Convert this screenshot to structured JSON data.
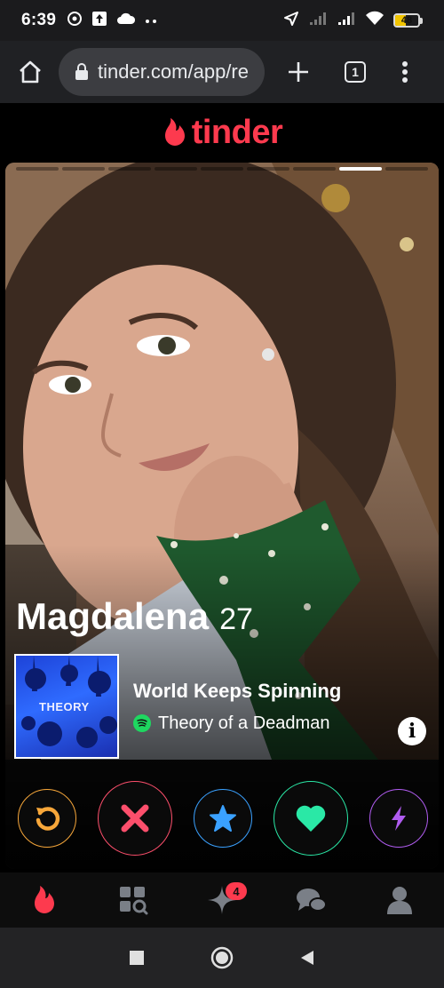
{
  "status_bar": {
    "time": "6:39",
    "battery_percent": "48",
    "battery_level": 0.48,
    "icons": [
      "whatsapp-icon",
      "upload-icon",
      "cloud-icon",
      "more-dots-icon",
      "location-arrow-icon",
      "signal-icon",
      "signal-icon",
      "wifi-icon",
      "battery-icon"
    ]
  },
  "browser": {
    "url": "tinder.com/app/re",
    "tab_count": "1",
    "icons": [
      "home-icon",
      "lock-icon",
      "plus-icon",
      "tabs-icon",
      "kebab-menu-icon"
    ]
  },
  "header": {
    "logo_text": "tinder",
    "brand_color": "#fd3a4e"
  },
  "profile": {
    "name": "Magdalena",
    "age": "27",
    "photo_count": 9,
    "active_photo": 8,
    "anthem": {
      "album_text": "THEORY",
      "song": "World Keeps Spinning",
      "artist": "Theory of a Deadman"
    }
  },
  "actions": {
    "rewind_color": "#f7a73a",
    "nope_color": "#fd4f6c",
    "superlike_color": "#3aa1ff",
    "like_color": "#2ae8a6",
    "boost_color": "#b05cf0"
  },
  "bottom_nav": {
    "items": [
      "flame-icon",
      "explore-icon",
      "sparkle-icon",
      "chat-icon",
      "profile-icon"
    ],
    "likes_badge": "4"
  },
  "system_nav": {
    "icons": [
      "recents-icon",
      "home-circle-icon",
      "back-icon"
    ]
  }
}
